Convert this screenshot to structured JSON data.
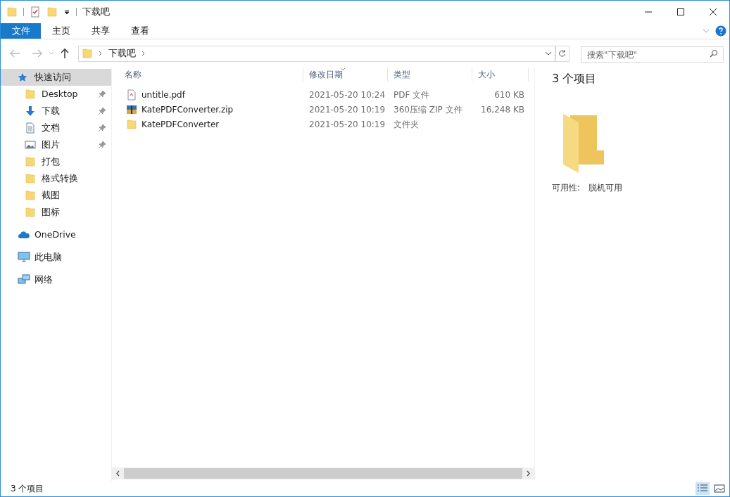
{
  "window": {
    "title": "下载吧"
  },
  "ribbon_tabs": [
    {
      "label": "文件",
      "kind": "file"
    },
    {
      "label": "主页",
      "kind": "tab"
    },
    {
      "label": "共享",
      "kind": "tab"
    },
    {
      "label": "查看",
      "kind": "tab"
    }
  ],
  "address_bar": {
    "path": [
      "下载吧"
    ]
  },
  "search": {
    "placeholder": "搜索\"下载吧\""
  },
  "sidebar": {
    "items": [
      {
        "label": "快速访问",
        "kind": "star",
        "selected": true,
        "children": [
          {
            "label": "Desktop",
            "kind": "folder",
            "pinned": true,
            "selected": false
          },
          {
            "label": "下载",
            "kind": "download",
            "pinned": true,
            "selected": false
          },
          {
            "label": "文档",
            "kind": "doc",
            "pinned": true,
            "selected": false
          },
          {
            "label": "图片",
            "kind": "picture",
            "pinned": true,
            "selected": false
          },
          {
            "label": "打包",
            "kind": "folder",
            "pinned": false,
            "selected": false
          },
          {
            "label": "格式转换",
            "kind": "folder",
            "pinned": false,
            "selected": false
          },
          {
            "label": "截图",
            "kind": "folder",
            "pinned": false,
            "selected": false
          },
          {
            "label": "图标",
            "kind": "folder",
            "pinned": false,
            "selected": false
          }
        ]
      },
      {
        "label": "OneDrive",
        "kind": "cloud",
        "selected": false
      },
      {
        "label": "此电脑",
        "kind": "pc",
        "selected": false
      },
      {
        "label": "网络",
        "kind": "network",
        "selected": false
      }
    ]
  },
  "table": {
    "columns": [
      {
        "label": "名称",
        "sorted": false
      },
      {
        "label": "修改日期",
        "sorted": true
      },
      {
        "label": "类型",
        "sorted": false
      },
      {
        "label": "大小",
        "sorted": false
      }
    ],
    "rows": [
      {
        "kind": "pdf",
        "name": "untitle.pdf",
        "modified": "2021-05-20 10:24",
        "type": "PDF 文件",
        "size": "610 KB"
      },
      {
        "kind": "zip",
        "name": "KatePDFConverter.zip",
        "modified": "2021-05-20 10:19",
        "type": "360压缩 ZIP 文件",
        "size": "16,248 KB"
      },
      {
        "kind": "folder",
        "name": "KatePDFConverter",
        "modified": "2021-05-20 10:19",
        "type": "文件夹",
        "size": ""
      }
    ]
  },
  "preview": {
    "title": "3 个项目",
    "availability_label": "可用性:",
    "availability_value": "脱机可用"
  },
  "status_bar": {
    "text": "3 个项目"
  }
}
